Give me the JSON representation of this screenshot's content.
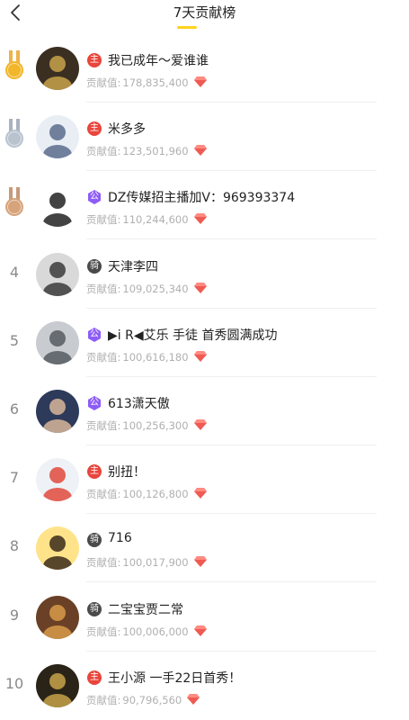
{
  "header": {
    "title": "7天贡献榜",
    "back_icon": "chevron-left-icon",
    "accent_color": "#ffd21f"
  },
  "contribution_label": "贡献值:",
  "gem_icon": "red-diamond-icon",
  "rows": [
    {
      "rank": "1",
      "medal": "gold",
      "badge": "主",
      "badge_color": "#e8453c",
      "name": "我已成年～爱谁谁",
      "value": "178,835,400"
    },
    {
      "rank": "2",
      "medal": "silver",
      "badge": "主",
      "badge_color": "#e8453c",
      "name": "米多多",
      "value": "123,501,960"
    },
    {
      "rank": "3",
      "medal": "bronze",
      "badge": "公",
      "badge_color": "#8d5cf6",
      "name": "DZ传媒招主播加V：969393374",
      "value": "110,244,600"
    },
    {
      "rank": "4",
      "medal": "",
      "badge": "骑",
      "badge_color": "#4a4a4a",
      "name": "天津李四",
      "value": "109,025,340"
    },
    {
      "rank": "5",
      "medal": "",
      "badge": "公",
      "badge_color": "#8d5cf6",
      "name": "▶i R◀艾乐 手徒 首秀圆满成功",
      "value": "100,616,180"
    },
    {
      "rank": "6",
      "medal": "",
      "badge": "公",
      "badge_color": "#8d5cf6",
      "name": "613潇天傲",
      "value": "100,256,300"
    },
    {
      "rank": "7",
      "medal": "",
      "badge": "主",
      "badge_color": "#e8453c",
      "name": "别扭！",
      "value": "100,126,800"
    },
    {
      "rank": "8",
      "medal": "",
      "badge": "骑",
      "badge_color": "#4a4a4a",
      "name": "716",
      "value": "100,017,900"
    },
    {
      "rank": "9",
      "medal": "",
      "badge": "骑",
      "badge_color": "#4a4a4a",
      "name": "二宝宝贾二常",
      "value": "100,006,000"
    },
    {
      "rank": "10",
      "medal": "",
      "badge": "主",
      "badge_color": "#e8453c",
      "name": "王小源 一手22日首秀！",
      "value": "90,796,560"
    }
  ]
}
